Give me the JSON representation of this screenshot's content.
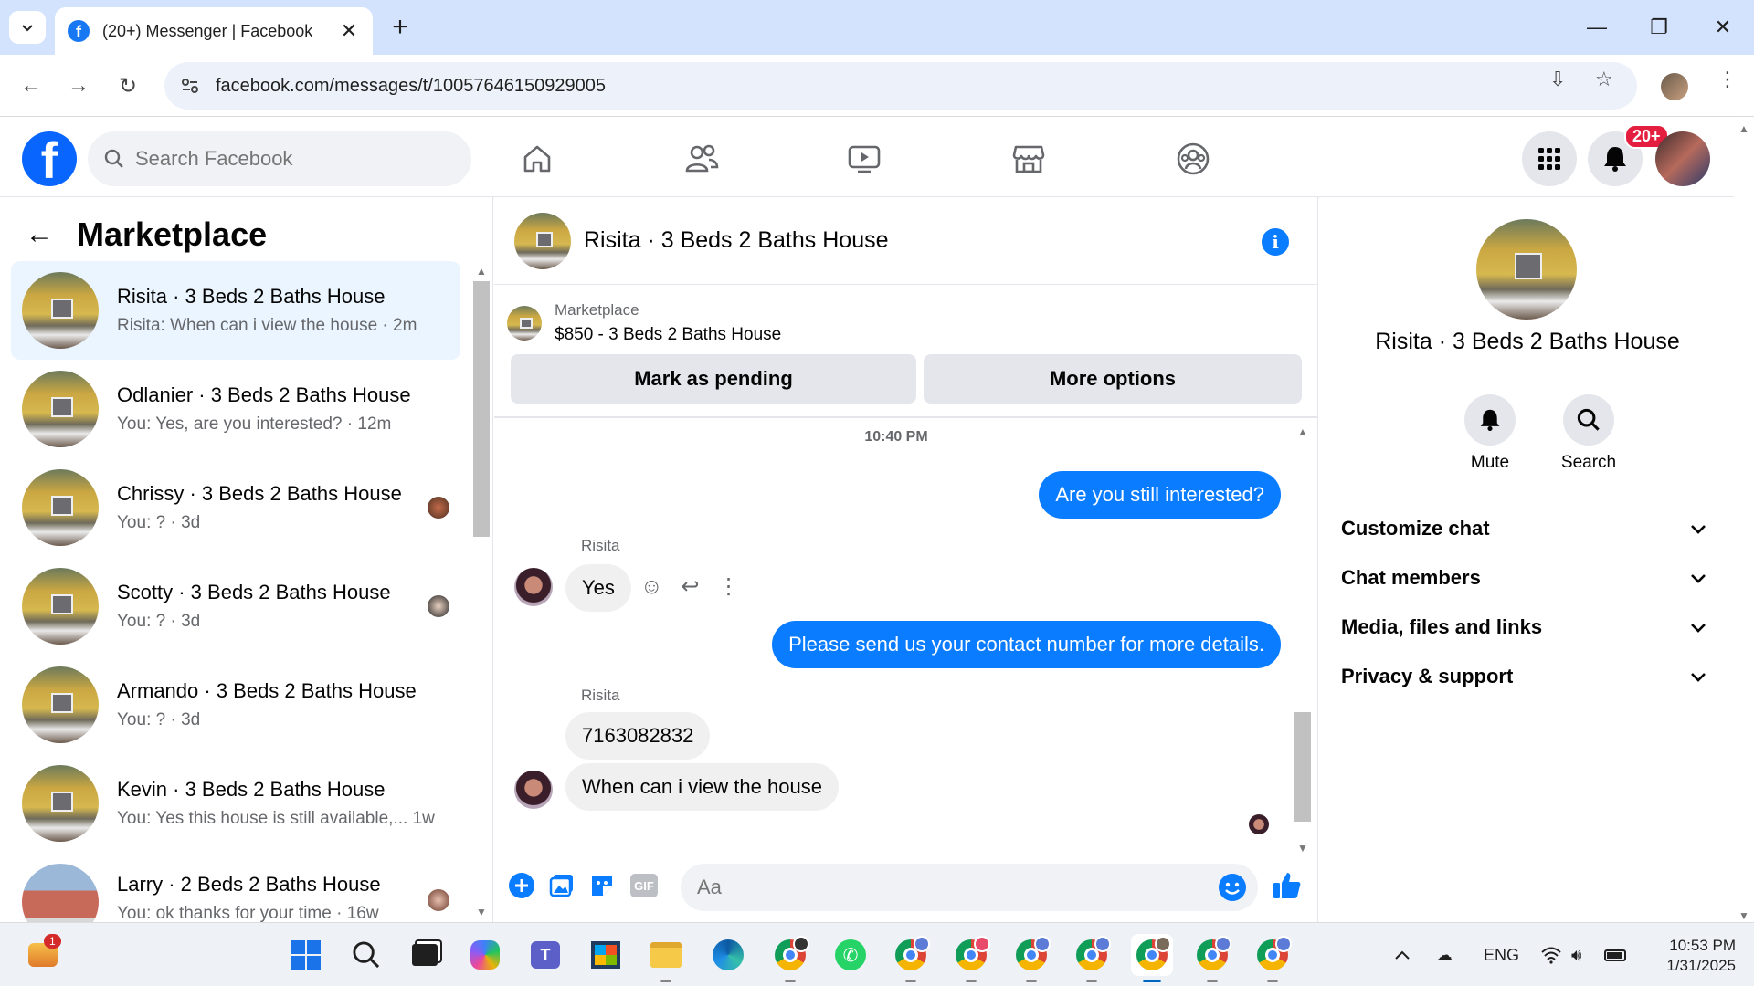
{
  "browser": {
    "tab_title": "(20+) Messenger | Facebook",
    "url": "facebook.com/messages/t/10057646150929005"
  },
  "fb": {
    "search_placeholder": "Search Facebook",
    "notification_count": "20+",
    "accent": "#0866ff"
  },
  "left": {
    "title": "Marketplace",
    "chats": [
      {
        "name": "Risita · 3 Beds 2 Baths House",
        "preview": "Risita: When can i view the house · 2m",
        "active": true
      },
      {
        "name": "Odlanier · 3 Beds 2 Baths House",
        "preview": "You: Yes, are you interested? · 12m"
      },
      {
        "name": "Chrissy · 3 Beds 2 Baths House",
        "preview": "You: ? · 3d"
      },
      {
        "name": "Scotty · 3 Beds 2 Baths House",
        "preview": "You: ? · 3d"
      },
      {
        "name": "Armando · 3 Beds 2 Baths House",
        "preview": "You: ? · 3d"
      },
      {
        "name": "Kevin · 3 Beds 2 Baths House",
        "preview": "You: Yes this house is still available,...  1w"
      },
      {
        "name": "Larry · 2 Beds 2 Baths House",
        "preview": "You: ok thanks for your time · 16w"
      }
    ]
  },
  "conversation": {
    "title": "Risita · 3 Beds 2 Baths House",
    "listing_label": "Marketplace",
    "listing_value": "$850 - 3 Beds 2 Baths House",
    "mark_pending": "Mark as pending",
    "more_options": "More options",
    "timestamp": "10:40 PM",
    "messages": [
      {
        "from": "me",
        "text": "Are you still interested?"
      },
      {
        "from": "Risita",
        "sender": "Risita",
        "text": "Yes"
      },
      {
        "from": "me",
        "text": "Please send us your contact number for more details."
      },
      {
        "from": "Risita",
        "sender": "Risita",
        "text": "7163082832"
      },
      {
        "from": "Risita",
        "text": "When can i view the house"
      }
    ],
    "composer_placeholder": "Aa",
    "bubble_color": "#0a7cff"
  },
  "right": {
    "name": "Risita · 3 Beds 2 Baths House",
    "mute": "Mute",
    "search": "Search",
    "sections": [
      "Customize chat",
      "Chat members",
      "Media, files and links",
      "Privacy & support"
    ]
  },
  "taskbar": {
    "lang": "ENG",
    "time": "10:53 PM",
    "date": "1/31/2025",
    "widget_badge": "1"
  }
}
